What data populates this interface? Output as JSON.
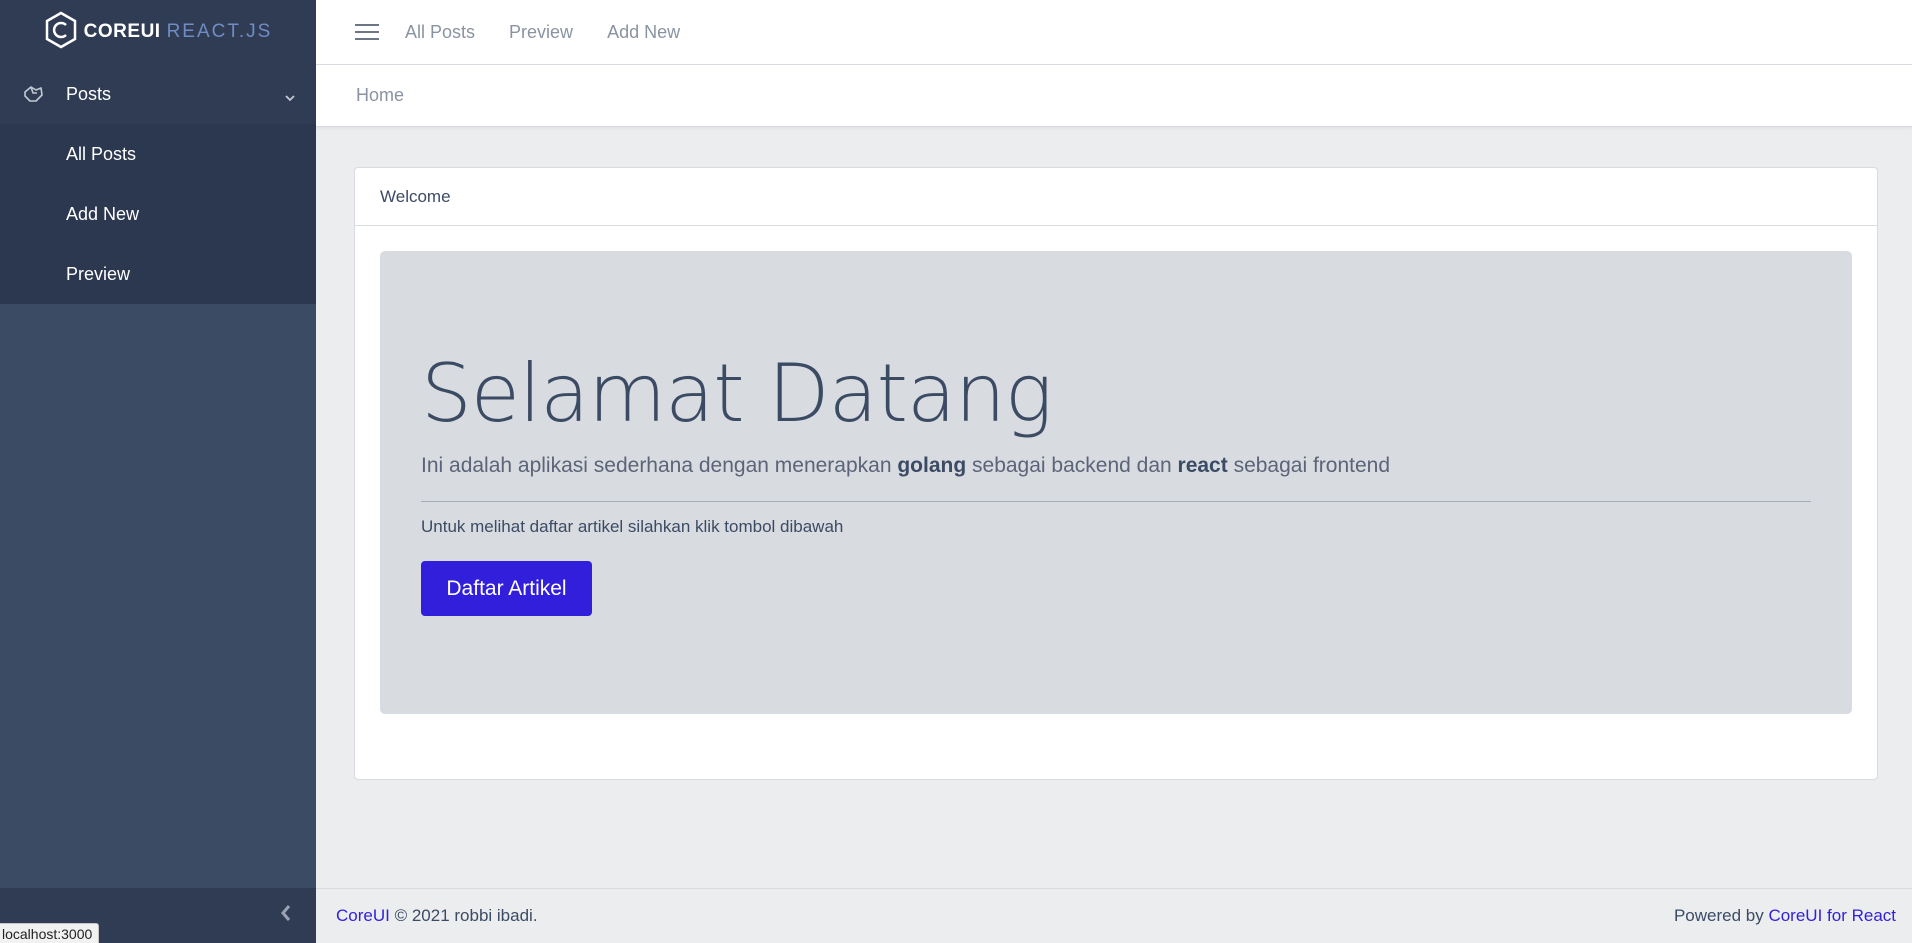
{
  "brand": {
    "name_bold": "COREUI",
    "name_light": "REACT.JS"
  },
  "sidebar": {
    "group_label": "Posts",
    "items": [
      {
        "label": "All Posts"
      },
      {
        "label": "Add New"
      },
      {
        "label": "Preview"
      }
    ]
  },
  "header": {
    "nav": [
      {
        "label": "All Posts"
      },
      {
        "label": "Preview"
      },
      {
        "label": "Add New"
      }
    ]
  },
  "breadcrumb": {
    "current": "Home"
  },
  "card": {
    "title": "Welcome",
    "heading": "Selamat Datang",
    "lead_part1": "Ini adalah aplikasi sederhana dengan menerapkan ",
    "lead_bold1": "golang",
    "lead_part2": " sebagai backend dan ",
    "lead_bold2": "react",
    "lead_part3": " sebagai frontend",
    "text": "Untuk melihat daftar artikel silahkan klik tombol dibawah",
    "button_label": "Daftar Artikel"
  },
  "footer": {
    "left_link": "CoreUI",
    "left_text": " © 2021 robbi ibadi.",
    "right_text": "Powered by ",
    "right_link": "CoreUI for React"
  },
  "status_bar": {
    "url": "localhost:3000"
  },
  "colors": {
    "primary": "#321fdb",
    "sidebar": "#3c4b64"
  }
}
